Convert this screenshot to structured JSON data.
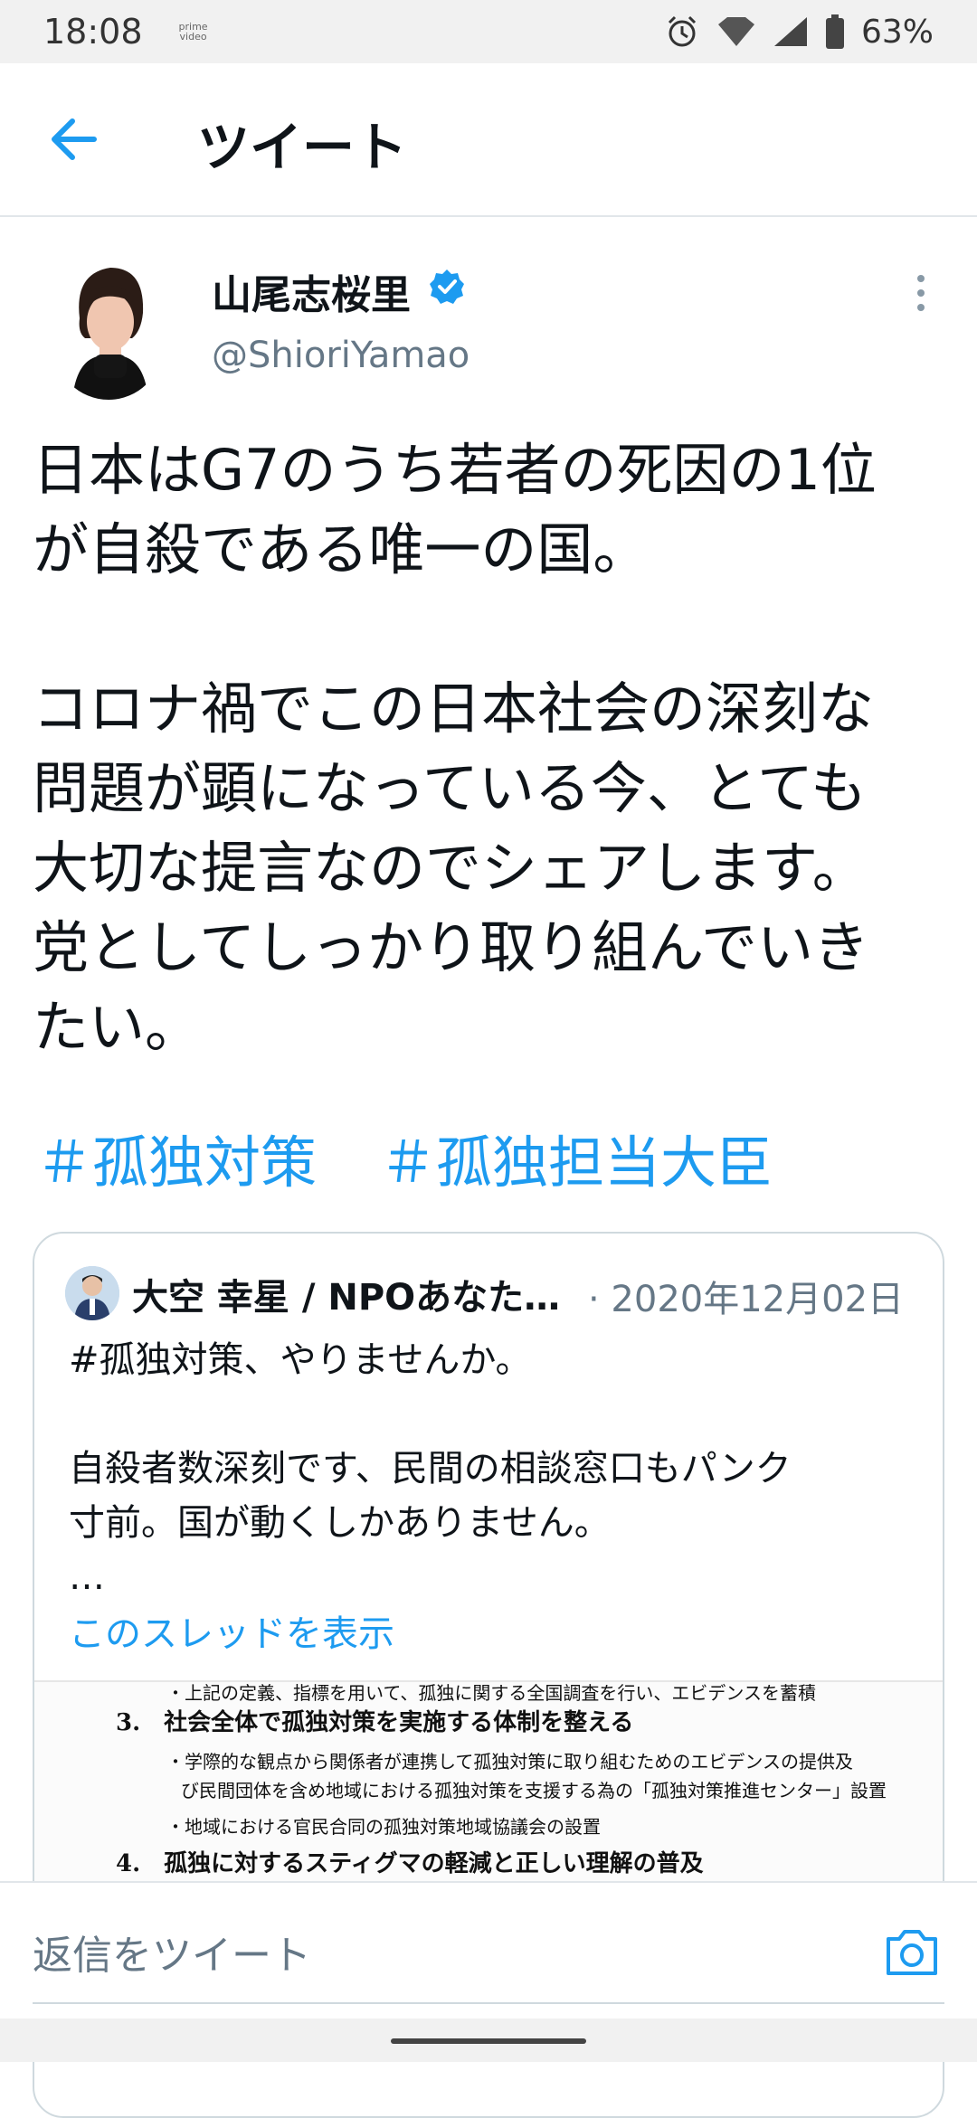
{
  "status_bar": {
    "time": "18:08",
    "prime_label_top": "prime",
    "prime_label_bottom": "video",
    "battery": "63%"
  },
  "header": {
    "title": "ツイート"
  },
  "tweet": {
    "author_name": "山尾志桜里",
    "author_handle": "@ShioriYamao",
    "text": "日本はG7のうち若者の死因の1位\nが自殺である唯一の国。\n\nコロナ禍でこの日本社会の深刻な\n問題が顕になっている今、とても\n大切な提言なのでシェアします。\n党としてしっかり取り組んでいき\nたい。",
    "hashtags": [
      "＃孤独対策",
      "＃孤独担当大臣"
    ]
  },
  "quoted_tweet": {
    "author": "大空 幸星 / NPOあなた…",
    "date": "· 2020年12月02日",
    "text": "#孤独対策、やりませんか。\n\n自殺者数深刻です、民間の相談窓口もパンク\n寸前。国が動くしかありません。\n…",
    "link": "このスレッドを表示",
    "image_lines": [
      "・上記の定義、指標を用いて、孤独に関する全国調査を行い、エビデンスを蓄積",
      "3.　社会全体で孤独対策を実施する体制を整える",
      "・学際的な観点から関係者が連携して孤独対策に取り組むためのエビデンスの提供及",
      "び民間団体を含め地域における孤独対策を支援する為の「孤独対策推進センター」設置",
      "・地域における官民合同の孤独対策地域協議会の設置",
      "4.　孤独に対するスティグマの軽減と正しい理解の普及"
    ]
  },
  "reply": {
    "placeholder": "返信をツイート"
  },
  "colors": {
    "accent": "#1d9bf0",
    "secondary_text": "#657786",
    "border": "#cfd9de"
  },
  "icons": [
    "back-arrow-icon",
    "verified-badge-icon",
    "more-vertical-icon",
    "camera-icon",
    "alarm-icon",
    "wifi-icon",
    "signal-icon",
    "battery-icon"
  ]
}
